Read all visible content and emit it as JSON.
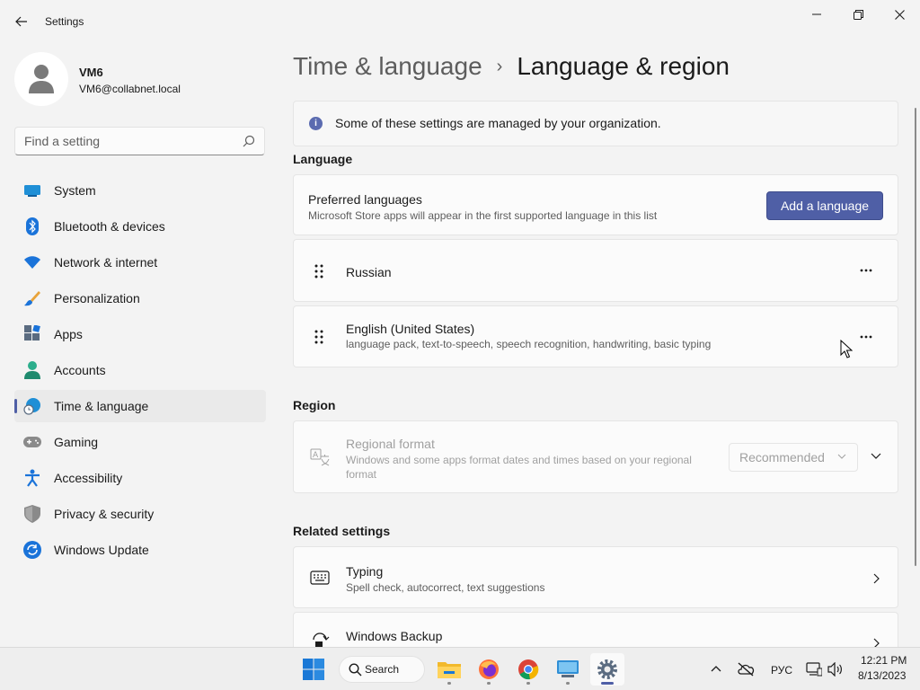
{
  "window": {
    "title": "Settings"
  },
  "profile": {
    "name": "VM6",
    "email": "VM6@collabnet.local"
  },
  "search": {
    "placeholder": "Find a setting"
  },
  "nav": {
    "items": [
      {
        "label": "System",
        "icon": "monitor-icon"
      },
      {
        "label": "Bluetooth & devices",
        "icon": "bluetooth-icon"
      },
      {
        "label": "Network & internet",
        "icon": "wifi-icon"
      },
      {
        "label": "Personalization",
        "icon": "brush-icon"
      },
      {
        "label": "Apps",
        "icon": "apps-icon"
      },
      {
        "label": "Accounts",
        "icon": "person-icon"
      },
      {
        "label": "Time & language",
        "icon": "globe-clock-icon",
        "active": true
      },
      {
        "label": "Gaming",
        "icon": "gamepad-icon"
      },
      {
        "label": "Accessibility",
        "icon": "accessibility-icon"
      },
      {
        "label": "Privacy & security",
        "icon": "shield-icon"
      },
      {
        "label": "Windows Update",
        "icon": "update-icon"
      }
    ]
  },
  "breadcrumb": {
    "parent": "Time & language",
    "separator": "›",
    "current": "Language & region"
  },
  "notice": {
    "text": "Some of these settings are managed by your organization."
  },
  "language": {
    "section_title": "Language",
    "preferred_title": "Preferred languages",
    "preferred_subtitle": "Microsoft Store apps will appear in the first supported language in this list",
    "add_button": "Add a language",
    "languages": [
      {
        "name": "Russian",
        "details": ""
      },
      {
        "name": "English (United States)",
        "details": "language pack, text-to-speech, speech recognition, handwriting, basic typing"
      }
    ]
  },
  "region": {
    "section_title": "Region",
    "regional_format_title": "Regional format",
    "regional_format_subtitle": "Windows and some apps format dates and times based on your regional format",
    "selected_value": "Recommended"
  },
  "related": {
    "section_title": "Related settings",
    "items": [
      {
        "title": "Typing",
        "subtitle": "Spell check, autocorrect, text suggestions"
      },
      {
        "title": "Windows Backup",
        "subtitle": ""
      }
    ]
  },
  "taskbar": {
    "search_label": "Search",
    "language_indicator": "РУС",
    "time": "12:21 PM",
    "date": "8/13/2023"
  },
  "colors": {
    "accent": "#4f5fa6",
    "background": "#f3f3f3",
    "card": "#fbfbfb"
  }
}
